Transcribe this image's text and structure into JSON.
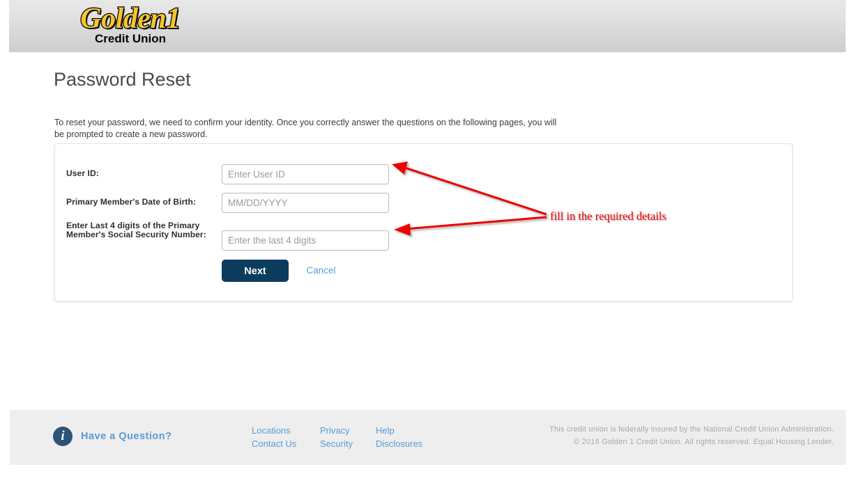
{
  "brand": {
    "logo_main": "Golden1",
    "logo_sub": "Credit Union"
  },
  "page": {
    "title": "Password Reset",
    "intro": "To reset your password, we need to confirm your identity. Once you correctly answer the questions on the following pages, you will be prompted to create a new password."
  },
  "form": {
    "fields": [
      {
        "label": "User ID:",
        "placeholder": "Enter User ID",
        "value": ""
      },
      {
        "label": "Primary Member's Date of Birth:",
        "placeholder": "MM/DD/YYYY",
        "value": ""
      },
      {
        "label": "Enter Last 4 digits of the Primary Member's Social Security Number:",
        "placeholder": "Enter the last 4 digits",
        "value": ""
      }
    ],
    "next_label": "Next",
    "cancel_label": "Cancel"
  },
  "annotation": {
    "text": "fill in the required details",
    "color": "#ee0000"
  },
  "footer": {
    "info_icon": "info-icon",
    "have_question": "Have a Question?",
    "columns": [
      {
        "links": [
          "Locations",
          "Contact Us"
        ]
      },
      {
        "links": [
          "Privacy",
          "Security"
        ]
      },
      {
        "links": [
          "Help",
          "Disclosures"
        ]
      }
    ],
    "legal_line1": "This credit union is federally insured by the National Credit Union Administration.",
    "legal_line2": "© 2016 Golden 1 Credit Union. All rights reserved. Equal Housing Lender."
  },
  "colors": {
    "brand_yellow": "#f5c431",
    "primary_navy": "#0b3c5d",
    "link_blue": "#5b9bd5",
    "annotation_red": "#ee0000"
  }
}
